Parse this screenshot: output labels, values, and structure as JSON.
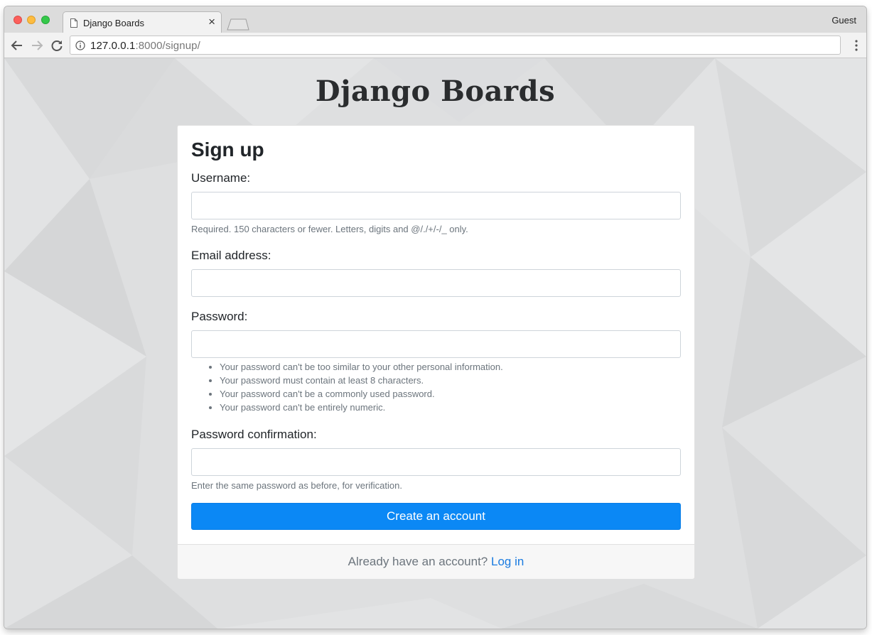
{
  "browser": {
    "tab": {
      "title": "Django Boards"
    },
    "profile": "Guest",
    "address": {
      "host": "127.0.0.1",
      "rest": ":8000/signup/"
    }
  },
  "page": {
    "brand": "Django Boards",
    "title": "Sign up",
    "fields": {
      "username": {
        "label": "Username:",
        "value": "",
        "help": "Required. 150 characters or fewer. Letters, digits and @/./+/-/_ only."
      },
      "email": {
        "label": "Email address:",
        "value": ""
      },
      "password": {
        "label": "Password:",
        "value": "",
        "help_items": [
          "Your password can't be too similar to your other personal information.",
          "Your password must contain at least 8 characters.",
          "Your password can't be a commonly used password.",
          "Your password can't be entirely numeric."
        ]
      },
      "password_confirm": {
        "label": "Password confirmation:",
        "value": "",
        "help": "Enter the same password as before, for verification."
      }
    },
    "submit_label": "Create an account",
    "footer": {
      "text": "Already have an account?",
      "link": "Log in"
    }
  },
  "colors": {
    "primary": "#0b88f5",
    "link": "#1a7be0",
    "muted": "#6c757d",
    "page_background": "#dedfe0"
  },
  "icons": {
    "back": "arrow-left-icon",
    "forward": "arrow-right-icon",
    "reload": "reload-icon",
    "info": "info-icon",
    "menu": "kebab-menu-icon",
    "tab": "document-icon",
    "close": "close-icon"
  }
}
